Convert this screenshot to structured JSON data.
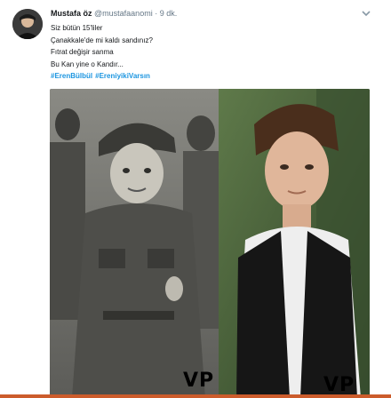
{
  "tweet": {
    "author_name": "Mustafa öz",
    "author_handle": "@mustafaanomi",
    "separator": "·",
    "time": "9 dk.",
    "lines": [
      "Siz bütün 15'liler",
      "Çanakkale'de mi kaldı sandınız?",
      "Fıtrat değişir sanma",
      "Bu Kan yine o Kandır..."
    ],
    "hashtags": [
      "#ErenBülbül",
      "#EreniyikiVarsın"
    ]
  },
  "icons": {
    "avatar": "avatar-photo",
    "menu": "chevron-down-icon"
  },
  "media": {
    "watermark": "VP"
  },
  "colors": {
    "link": "#1b95e0",
    "secondary_text": "#657786",
    "accent_strip": "#cc5c2c"
  }
}
